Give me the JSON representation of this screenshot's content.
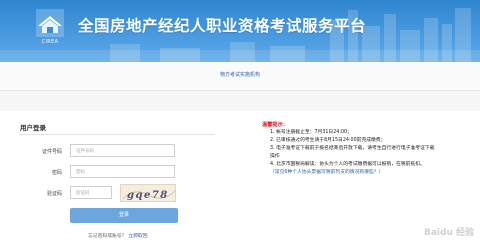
{
  "header": {
    "logo_text": "CIREA",
    "site_title": "全国房地产经纪人职业资格考试服务平台"
  },
  "subnav": {
    "link": "物方考试实施机构"
  },
  "login": {
    "title": "用户登录",
    "id_label": "证件号码",
    "id_placeholder": "证件号码",
    "password_label": "密码",
    "password_placeholder": "密码",
    "captcha_label": "验证码",
    "captcha_placeholder": "验证码",
    "captcha_text": "gqe78",
    "submit_label": "登录",
    "forgot_prefix": "忘记密码或账号？",
    "forgot_link": "立即取回"
  },
  "notice": {
    "title": "温馨提示：",
    "items": [
      "1.  帐号注册截止至：7月31日24:00；",
      "2.  已审核通过的考生请于8月15日24:00前完成缴费；",
      "3.  电子准考证下载前于报名结束后开放下载，请考生自行进行电子准考证下载",
      "     操作",
      "4.  北京市国税局解读：协头为个人的考试缴费据可以报销，在税前抵扣。"
    ],
    "link": "（常见6种个人协头票据可税前列支的情况有哪些？）"
  },
  "watermark": "Baidu 经验",
  "colors": {
    "banner": "#3a90d8",
    "button": "#6da6dc",
    "notice_red": "#d9232a",
    "link_blue": "#2b5fa8"
  }
}
